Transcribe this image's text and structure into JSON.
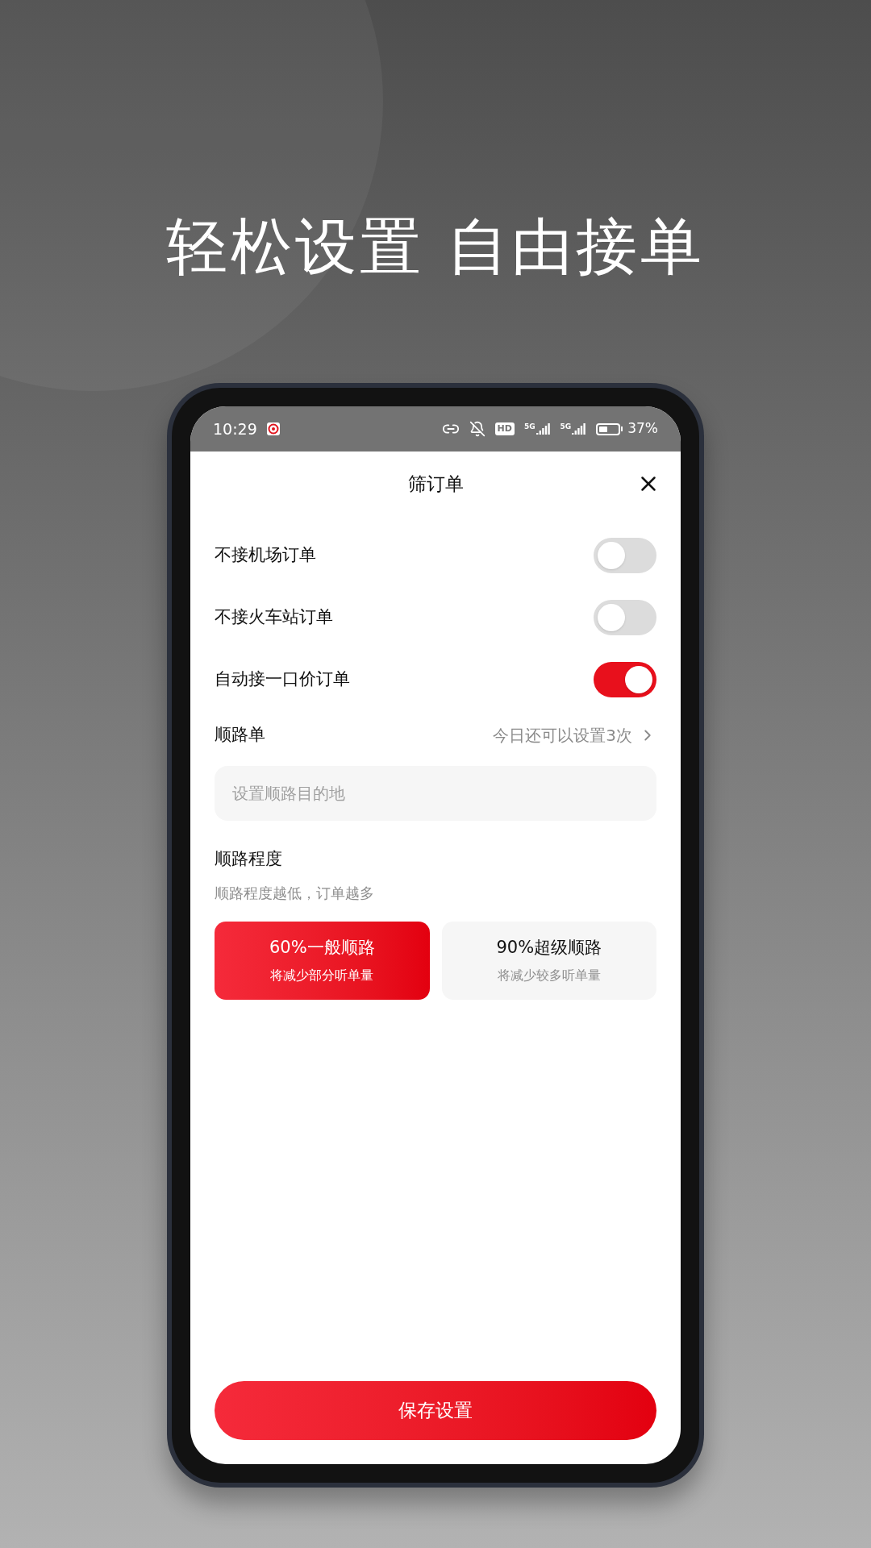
{
  "headline": "轻松设置 自由接单",
  "status_bar": {
    "time": "10:29",
    "icons": [
      {
        "kind": "app"
      },
      {
        "kind": "link"
      },
      {
        "kind": "mute"
      },
      {
        "kind": "hd",
        "label": "HD"
      },
      {
        "kind": "signal",
        "label": "5G"
      },
      {
        "kind": "signal",
        "label": "5G"
      },
      {
        "kind": "battery"
      }
    ],
    "battery_text": "37%"
  },
  "sheet": {
    "title": "筛订单"
  },
  "switches": [
    {
      "label": "不接机场订单",
      "on": false
    },
    {
      "label": "不接火车站订单",
      "on": false
    },
    {
      "label": "自动接一口价订单",
      "on": true
    }
  ],
  "route": {
    "label": "顺路单",
    "hint": "今日还可以设置3次",
    "placeholder": "设置顺路目的地"
  },
  "degree": {
    "label": "顺路程度",
    "description": "顺路程度越低，订单越多",
    "options": [
      {
        "title": "60%一般顺路",
        "subtitle": "将减少部分听单量",
        "selected": true
      },
      {
        "title": "90%超级顺路",
        "subtitle": "将减少较多听单量",
        "selected": false
      }
    ]
  },
  "save_button": "保存设置"
}
